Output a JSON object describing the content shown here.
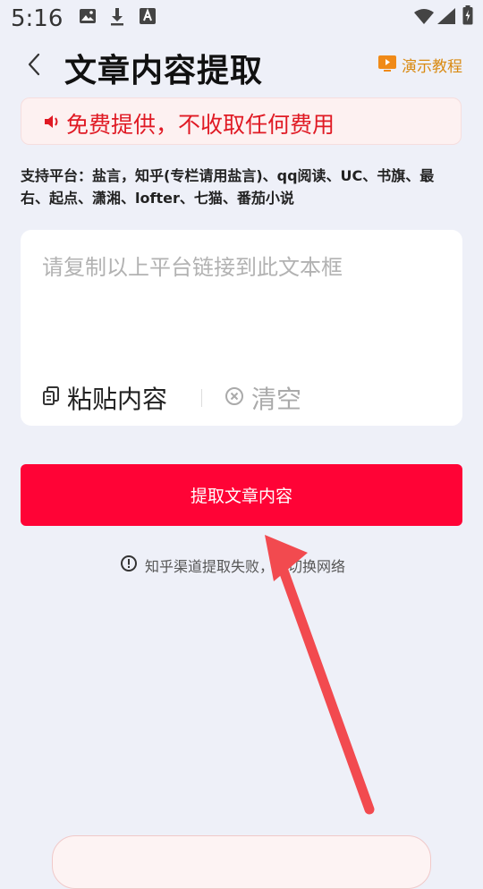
{
  "status_bar": {
    "time": "5:16",
    "icons": [
      "image-icon",
      "download-icon",
      "font-icon",
      "wifi-icon",
      "signal-icon",
      "battery-icon"
    ]
  },
  "header": {
    "title": "文章内容提取",
    "tutorial_label": "演示教程"
  },
  "banner": {
    "text": "免费提供，不收取任何费用"
  },
  "platforms": {
    "text": "支持平台：盐言，知乎(专栏请用盐言)、qq阅读、UC、书旗、最右、起点、潇湘、lofter、七猫、番茄小说"
  },
  "input": {
    "placeholder": "请复制以上平台链接到此文本框",
    "value": ""
  },
  "actions": {
    "paste_label": "粘贴内容",
    "clear_label": "清空"
  },
  "extract_button": {
    "label": "提取文章内容"
  },
  "notice": {
    "text": "知乎渠道提取失败，请切换网络"
  },
  "colors": {
    "accent": "#ff0336",
    "banner_text": "#e01a24",
    "tutorial": "#d98a12",
    "annotation_arrow": "#f24a4f"
  }
}
